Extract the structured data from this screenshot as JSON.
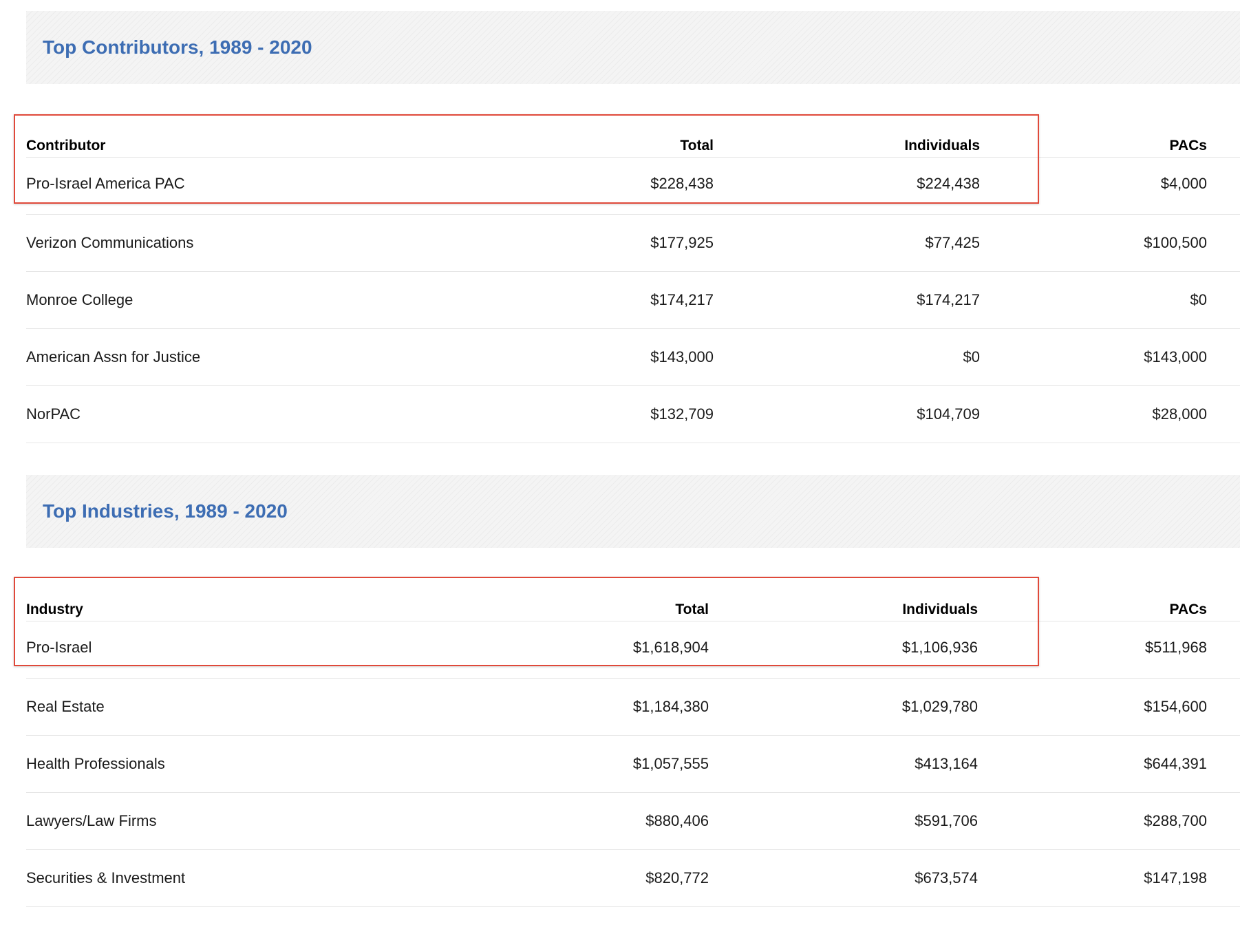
{
  "contributors": {
    "title": "Top Contributors, 1989 - 2020",
    "headers": {
      "name": "Contributor",
      "total": "Total",
      "individuals": "Individuals",
      "pacs": "PACs"
    },
    "rows": [
      {
        "name": "Pro-Israel America PAC",
        "total": "$228,438",
        "individuals": "$224,438",
        "pacs": "$4,000"
      },
      {
        "name": "Verizon Communications",
        "total": "$177,925",
        "individuals": "$77,425",
        "pacs": "$100,500"
      },
      {
        "name": "Monroe College",
        "total": "$174,217",
        "individuals": "$174,217",
        "pacs": "$0"
      },
      {
        "name": "American Assn for Justice",
        "total": "$143,000",
        "individuals": "$0",
        "pacs": "$143,000"
      },
      {
        "name": "NorPAC",
        "total": "$132,709",
        "individuals": "$104,709",
        "pacs": "$28,000"
      }
    ]
  },
  "industries": {
    "title": "Top Industries, 1989 - 2020",
    "headers": {
      "name": "Industry",
      "total": "Total",
      "individuals": "Individuals",
      "pacs": "PACs"
    },
    "rows": [
      {
        "name": "Pro-Israel",
        "total": "$1,618,904",
        "individuals": "$1,106,936",
        "pacs": "$511,968"
      },
      {
        "name": "Real Estate",
        "total": "$1,184,380",
        "individuals": "$1,029,780",
        "pacs": "$154,600"
      },
      {
        "name": "Health Professionals",
        "total": "$1,057,555",
        "individuals": "$413,164",
        "pacs": "$644,391"
      },
      {
        "name": "Lawyers/Law Firms",
        "total": "$880,406",
        "individuals": "$591,706",
        "pacs": "$288,700"
      },
      {
        "name": "Securities & Investment",
        "total": "$820,772",
        "individuals": "$673,574",
        "pacs": "$147,198"
      }
    ]
  },
  "highlight_color": "#e0493a",
  "title_color": "#3d6db3"
}
